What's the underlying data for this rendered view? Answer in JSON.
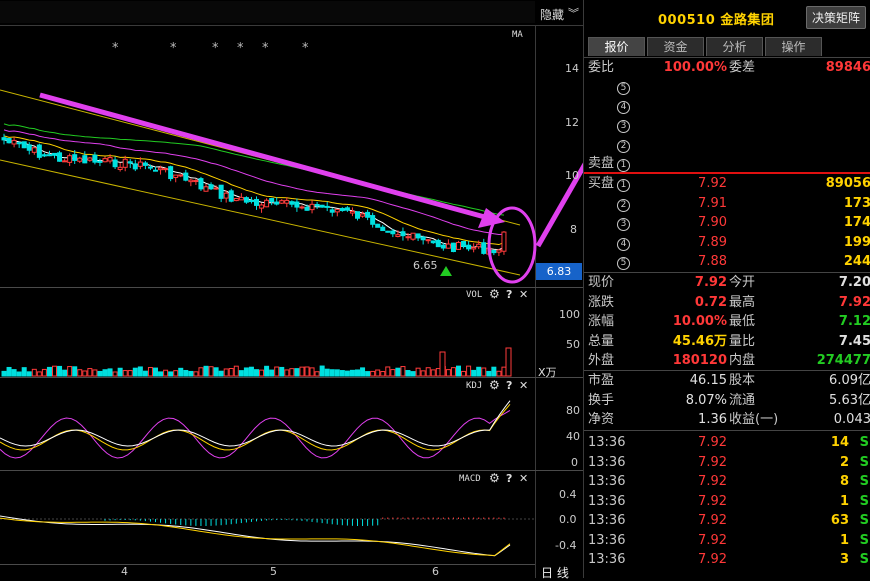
{
  "chart": {
    "hide_label": "隐藏",
    "ma_label": "MA",
    "price_axis": [
      "14",
      "12",
      "10",
      "8"
    ],
    "current_price": "6.83",
    "low_label": "6.65",
    "vol_label": "VOL",
    "vol_axis": [
      "100",
      "50"
    ],
    "vol_unit": "X万",
    "kdj_label": "KDJ",
    "kdj_axis": [
      "80",
      "40",
      "0"
    ],
    "macd_label": "MACD",
    "macd_axis": [
      "0.4",
      "0.0",
      "-0.4"
    ],
    "months": [
      "4",
      "5",
      "6"
    ],
    "period_label": "日 线",
    "help": "?",
    "close": "✕"
  },
  "quote": {
    "code": "000510",
    "name": "金路集团",
    "btn": "决策矩阵",
    "tabs": [
      "报价",
      "资金",
      "分析",
      "操作"
    ],
    "weibi_label": "委比",
    "weibi": "100.00%",
    "weicha_label": "委差",
    "weicha": "89846",
    "sell_label": "卖盘",
    "buy_label": "买盘",
    "bids": [
      [
        "1",
        "7.92",
        "89056"
      ],
      [
        "2",
        "7.91",
        "173"
      ],
      [
        "3",
        "7.90",
        "174"
      ],
      [
        "4",
        "7.89",
        "199"
      ],
      [
        "5",
        "7.88",
        "244"
      ]
    ],
    "stats": [
      [
        "现价",
        "7.92",
        "今开",
        "7.20"
      ],
      [
        "涨跌",
        "0.72",
        "最高",
        "7.92"
      ],
      [
        "涨幅",
        "10.00%",
        "最低",
        "7.12"
      ],
      [
        "总量",
        "45.46万",
        "量比",
        "7.45"
      ],
      [
        "外盘",
        "180120",
        "内盘",
        "274477"
      ]
    ],
    "stats2": [
      [
        "市盈",
        "46.15",
        "股本",
        "6.09亿"
      ],
      [
        "换手",
        "8.07%",
        "流通",
        "5.63亿"
      ],
      [
        "净资",
        "1.36",
        "收益(一)",
        "0.043"
      ]
    ],
    "ticks": [
      [
        "13:36",
        "7.92",
        "14",
        "S"
      ],
      [
        "13:36",
        "7.92",
        "2",
        "S"
      ],
      [
        "13:36",
        "7.92",
        "8",
        "S"
      ],
      [
        "13:36",
        "7.92",
        "1",
        "S"
      ],
      [
        "13:36",
        "7.92",
        "63",
        "S"
      ],
      [
        "13:36",
        "7.92",
        "1",
        "S"
      ],
      [
        "13:36",
        "7.92",
        "3",
        "S"
      ]
    ]
  }
}
